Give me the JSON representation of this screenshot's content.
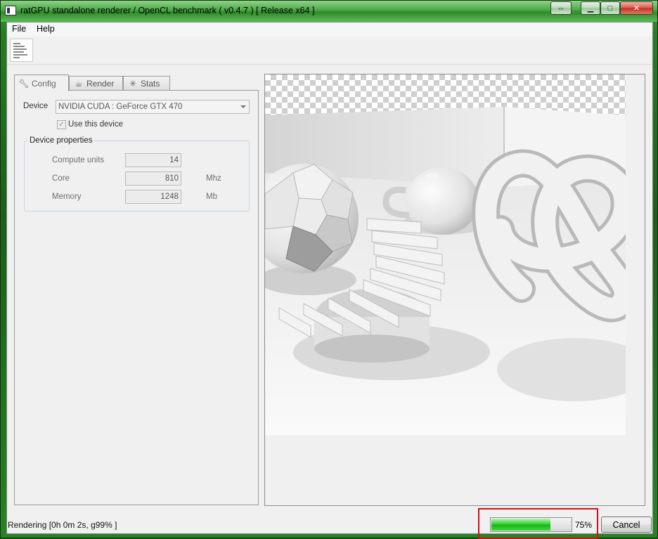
{
  "window": {
    "title": "ratGPU standalone renderer / OpenCL benchmark ( v0.4.7 ) [ Release x64 ]"
  },
  "menu": {
    "file": "File",
    "help": "Help"
  },
  "tabs": [
    {
      "label": "Config",
      "icon": "wrench-icon"
    },
    {
      "label": "Render",
      "icon": "teapot-icon"
    },
    {
      "label": "Stats",
      "icon": "fan-icon"
    }
  ],
  "config": {
    "device_label": "Device",
    "device_value": "NVIDIA CUDA : GeForce GTX 470",
    "use_device_label": "Use this device",
    "use_device_checked": true,
    "properties_title": "Device properties",
    "properties": [
      {
        "label": "Compute units",
        "value": "14",
        "unit": ""
      },
      {
        "label": "Core",
        "value": "810",
        "unit": "Mhz"
      },
      {
        "label": "Memory",
        "value": "1248",
        "unit": "Mb"
      }
    ]
  },
  "status": {
    "text": "Rendering [0h 0m 2s, g99% ]",
    "progress_percent": 75,
    "progress_label": "75%",
    "cancel_label": "Cancel",
    "highlight_color": "#d40f1b",
    "progress_color": "#2ecc2e"
  }
}
